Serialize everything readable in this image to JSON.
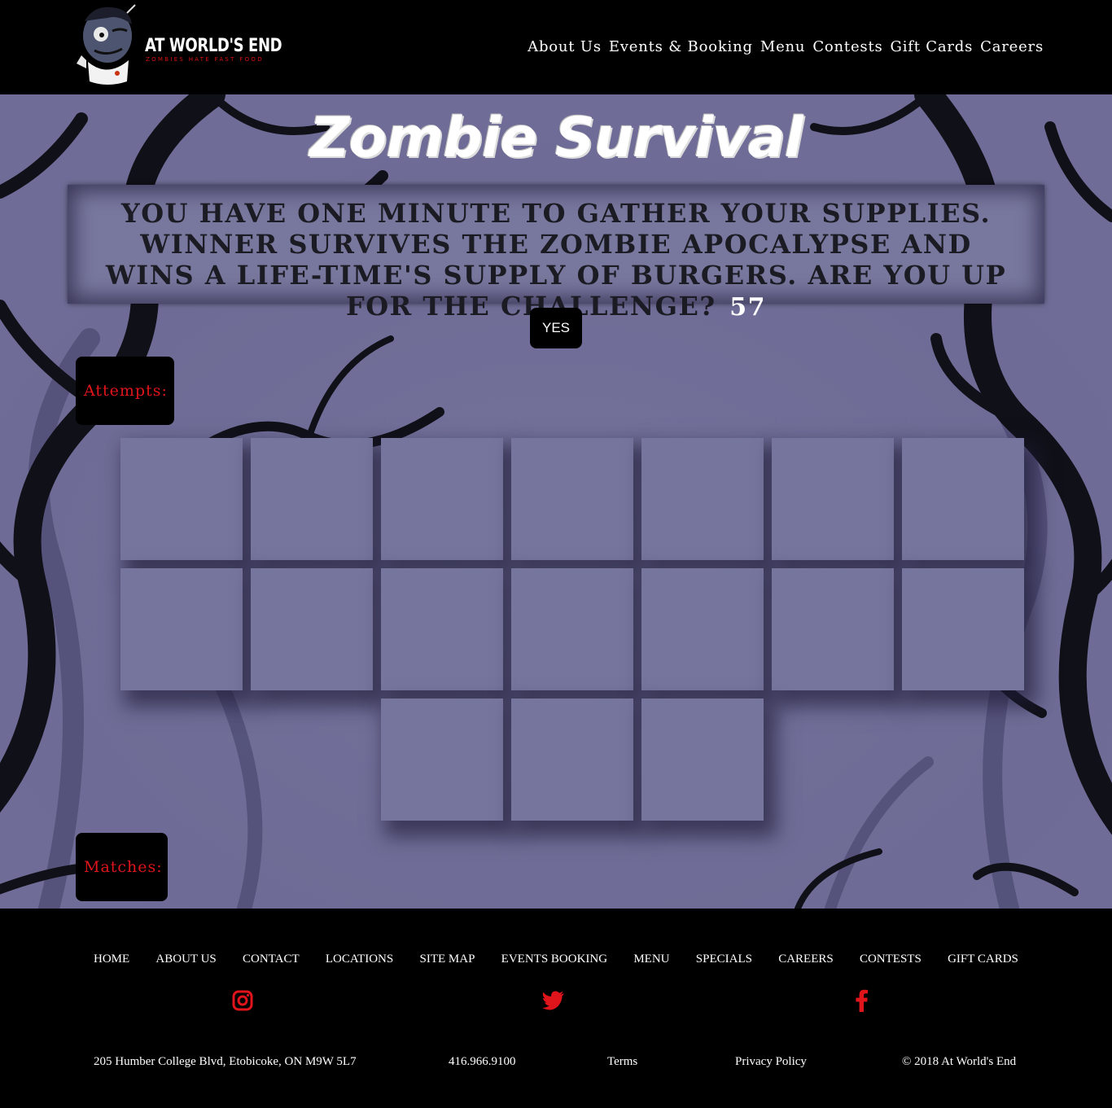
{
  "brand": {
    "name": "AT WORLD'S END",
    "tagline": "ZOMBIES HATE FAST FOOD",
    "accent": "#e0141b"
  },
  "nav": [
    "About Us",
    "Events & Booking",
    "Menu",
    "Contests",
    "Gift Cards",
    "Careers"
  ],
  "game": {
    "title": "Zombie Survival",
    "intro": "YOU HAVE ONE MINUTE TO GATHER YOUR SUPPLIES. WINNER SURVIVES THE ZOMBIE APOCALYPSE AND WINS A LIFE-TIME'S SUPPLY OF BURGERS. ARE YOU UP FOR THE CHALLENGE?",
    "timer": "57",
    "yes_label": "YES",
    "attempts_label": "Attempts:",
    "matches_label": "Matches:",
    "card_count": 17,
    "background_color": "#6f6d97"
  },
  "footer": {
    "links": [
      "HOME",
      "ABOUT US",
      "CONTACT",
      "LOCATIONS",
      "SITE MAP",
      "EVENTS BOOKING",
      "MENU",
      "SPECIALS",
      "CAREERS",
      "CONTESTS",
      "GIFT CARDS"
    ],
    "social": [
      "instagram-icon",
      "twitter-icon",
      "facebook-icon"
    ],
    "address": "205 Humber College Blvd, Etobicoke, ON M9W 5L7",
    "phone": "416.966.9100",
    "terms": "Terms",
    "privacy": "Privacy Policy",
    "copyright": "© 2018 At World's End"
  }
}
